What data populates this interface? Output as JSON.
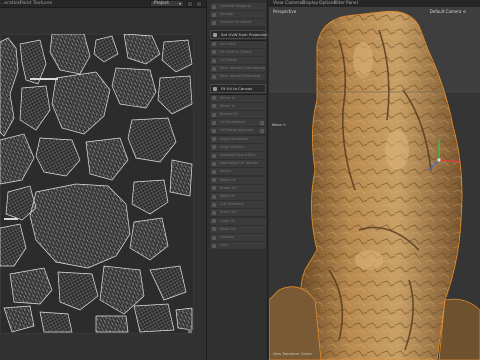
{
  "uv_editor": {
    "menus": [
      "...eration",
      "Paint",
      "Textures"
    ],
    "view_select": "Project"
  },
  "palette": {
    "items": [
      {
        "label": "Optimal Mapping",
        "active": false,
        "option": false
      },
      {
        "label": "Realign",
        "active": false,
        "option": false
      },
      {
        "label": "Terrace UV Island",
        "active": false,
        "option": false
      },
      {
        "label": "Set UVW from Projection",
        "active": true,
        "option": true,
        "header": true
      },
      {
        "label": "Set UVW",
        "active": false,
        "option": false
      },
      {
        "label": "Fit UVW to Object",
        "active": false,
        "option": false
      },
      {
        "label": "UV Peeler",
        "active": false,
        "option": false
      },
      {
        "label": "Pack Islands Overlapping",
        "active": false,
        "option": false
      },
      {
        "label": "Pack Islands Bounding",
        "active": false,
        "option": false
      },
      {
        "label": "Fit UV to Canvas",
        "active": true,
        "option": false,
        "header": true
      },
      {
        "label": "Mirror U",
        "active": false,
        "option": false
      },
      {
        "label": "Mirror V",
        "active": false,
        "option": false
      },
      {
        "label": "Rotate UV",
        "active": false,
        "option": false
      },
      {
        "label": "UV Straighten",
        "active": false,
        "option": true
      },
      {
        "label": "UV Rectangularize",
        "active": false,
        "option": true
      },
      {
        "label": "Align Horizontal",
        "active": false,
        "option": false
      },
      {
        "label": "Align Vertical",
        "active": false,
        "option": false
      },
      {
        "label": "Equalize Island Size",
        "active": false,
        "option": false
      },
      {
        "label": "Normalize UV Islands",
        "active": false,
        "option": false
      },
      {
        "label": "Select",
        "active": false,
        "option": false
      },
      {
        "label": "Relax UV",
        "active": false,
        "option": false
      },
      {
        "label": "Break UV",
        "active": false,
        "option": false
      },
      {
        "label": "Weld UV",
        "active": false,
        "option": false
      },
      {
        "label": "Cut Selected",
        "active": false,
        "option": false
      },
      {
        "label": "Stitch UV",
        "active": false,
        "option": false
      },
      {
        "label": "Copy UV",
        "active": false,
        "option": false
      },
      {
        "label": "Paste UV",
        "active": false,
        "option": false
      },
      {
        "label": "Unwrap",
        "active": false,
        "option": false
      },
      {
        "label": "Grid",
        "active": false,
        "option": false
      }
    ]
  },
  "viewport": {
    "menus": [
      "View",
      "Cameras",
      "Display",
      "Options",
      "Filter",
      "Panel"
    ],
    "camera": "Perspective",
    "default_camera": "Default Camera ⟲",
    "move_label": "Move ↔",
    "bottom_label": "View Transform: Scene"
  },
  "colors": {
    "rock_light": "#c79a5c",
    "rock_mid": "#9a7040",
    "rock_dark": "#5a4023",
    "uv_line": "#d9d9d9",
    "panel_bg": "#313131",
    "viewport_bg": "#3b3b3b"
  }
}
